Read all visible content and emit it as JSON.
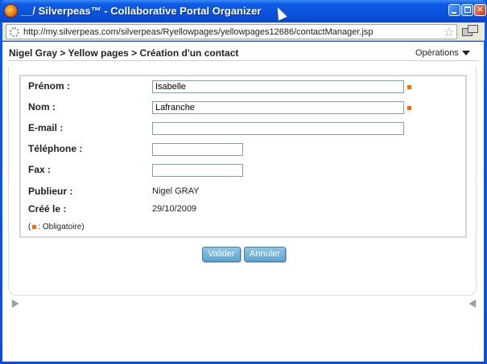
{
  "window": {
    "title": "__/ Silverpeas™ - Collaborative Portal Organizer",
    "url": "http://my.silverpeas.com/silverpeas/Ryellowpages/yellowpages12686/contactManager.jsp"
  },
  "header": {
    "breadcrumb": "Nigel Gray > Yellow pages > Création d'un contact",
    "operations_label": "Opérations"
  },
  "form": {
    "fields": [
      {
        "label": "Prénom :",
        "value": "Isabelle",
        "required": true
      },
      {
        "label": "Nom :",
        "value": "Lafranche",
        "required": true
      },
      {
        "label": "E-mail :",
        "value": "",
        "required": false
      },
      {
        "label": "Téléphone :",
        "value": "",
        "required": false
      },
      {
        "label": "Fax :",
        "value": "",
        "required": false
      }
    ],
    "info": [
      {
        "label": "Publieur :",
        "value": "Nigel GRAY"
      },
      {
        "label": "Créé le :",
        "value": "29/10/2009"
      }
    ],
    "legend_prefix": "(",
    "legend_text": ": Obligatoire)",
    "required_color": "#f07000"
  },
  "actions": {
    "validate_label": "Valider",
    "cancel_label": "Annuler"
  },
  "icons": [
    "firefox-icon",
    "minimize-icon",
    "maximize-icon",
    "close-icon",
    "loading-icon",
    "bookmark-star-icon",
    "screens-icon",
    "dropdown-arrow-icon"
  ]
}
